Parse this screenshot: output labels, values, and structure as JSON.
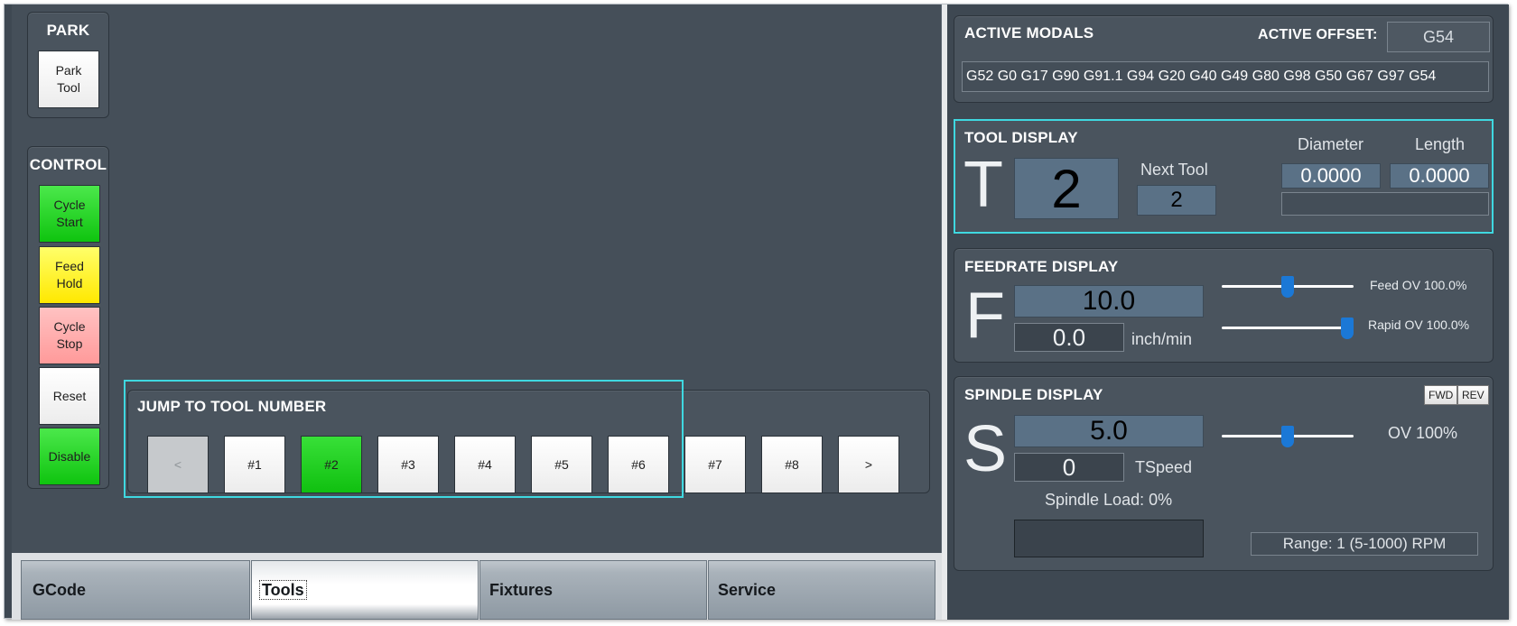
{
  "park": {
    "title": "PARK",
    "park_tool_label": "Park\nTool"
  },
  "control": {
    "title": "CONTROL",
    "buttons": {
      "cycle_start": "Cycle\nStart",
      "feed_hold": "Feed\nHold",
      "cycle_stop": "Cycle\nStop",
      "reset": "Reset",
      "disable": "Disable"
    }
  },
  "jump": {
    "title": "JUMP TO TOOL NUMBER",
    "prev_label": "<",
    "tools": [
      "#1",
      "#2",
      "#3",
      "#4",
      "#5",
      "#6",
      "#7",
      "#8"
    ],
    "active_tool": "#2",
    "next_label": ">"
  },
  "tabs": [
    {
      "label": "GCode"
    },
    {
      "label": "Tools"
    },
    {
      "label": "Fixtures"
    },
    {
      "label": "Service"
    }
  ],
  "active_tab": "Tools",
  "modals": {
    "title": "ACTIVE MODALS",
    "offset_label": "ACTIVE OFFSET:",
    "offset_value": "G54",
    "codes": "G52 G0 G17 G90 G91.1 G94 G20 G40 G49 G80 G98 G50 G67 G97 G54"
  },
  "tool_display": {
    "title": "TOOL DISPLAY",
    "letter": "T",
    "current_tool": "2",
    "next_tool_label": "Next Tool",
    "next_tool": "2",
    "diameter_label": "Diameter",
    "diameter": "0.0000",
    "length_label": "Length",
    "length": "0.0000",
    "description": ""
  },
  "feedrate": {
    "title": "FEEDRATE DISPLAY",
    "letter": "F",
    "commanded": "10.0",
    "actual": "0.0",
    "units": "inch/min",
    "feed_ov_label": "Feed OV 100.0%",
    "feed_ov_level": 0.5,
    "rapid_ov_label": "Rapid OV 100.0%",
    "rapid_ov_level": 1.0
  },
  "spindle": {
    "title": "SPINDLE DISPLAY",
    "letter": "S",
    "fwd_label": "FWD",
    "rev_label": "REV",
    "commanded": "5.0",
    "actual": "0",
    "tspeed_label": "TSpeed",
    "ov_label": "OV 100%",
    "ov_level": 0.5,
    "load_label": "Spindle Load: 0%",
    "range_label": "Range: 1 (5-1000) RPM"
  },
  "colors": {
    "highlight": "#3fd8e0",
    "active_green": "#10c010",
    "slider_thumb": "#1b78d6"
  }
}
